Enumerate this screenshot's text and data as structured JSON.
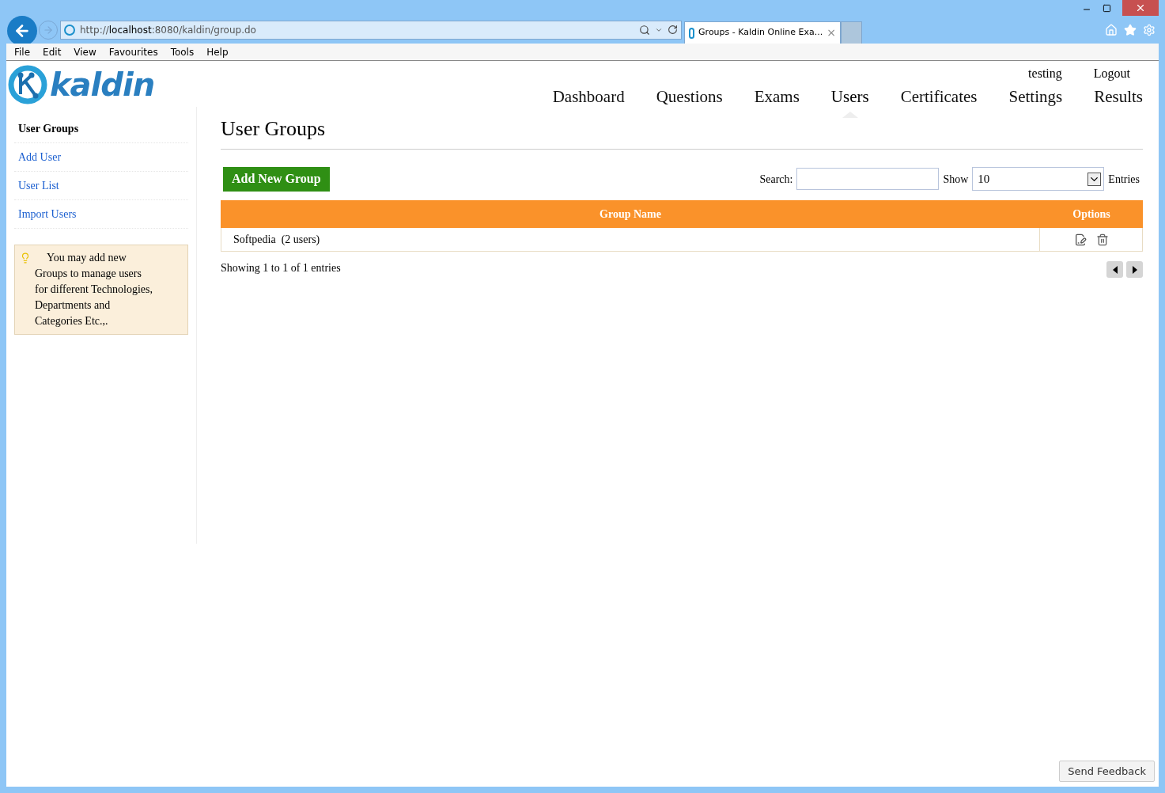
{
  "browser": {
    "url": "http://**localhost**:8080/kaldin/group.do",
    "tab_title": "Groups - Kaldin Online Exa...",
    "tab_close": "×",
    "menu": [
      "File",
      "Edit",
      "View",
      "Favourites",
      "Tools",
      "Help"
    ]
  },
  "header": {
    "logo_text": "kaldin",
    "user": "testing",
    "logout": "Logout",
    "nav": [
      {
        "label": "Dashboard",
        "selected": false
      },
      {
        "label": "Questions",
        "selected": false
      },
      {
        "label": "Exams",
        "selected": false
      },
      {
        "label": "Users",
        "selected": true
      },
      {
        "label": "Certificates",
        "selected": false
      },
      {
        "label": "Settings",
        "selected": false
      },
      {
        "label": "Results",
        "selected": false
      }
    ]
  },
  "sidebar": {
    "items": [
      {
        "label": "User Groups",
        "selected": true
      },
      {
        "label": "Add User",
        "selected": false
      },
      {
        "label": "User List",
        "selected": false
      },
      {
        "label": "Import Users",
        "selected": false
      }
    ],
    "tip": "You may add new Groups to manage users for different Technologies, Departments and Categories Etc.,."
  },
  "main": {
    "title": "User Groups",
    "add_button": "Add New Group",
    "search_label": "Search:",
    "show_label": "Show",
    "page_size": "10",
    "entries_label": "Entries",
    "table": {
      "columns": [
        "Group Name",
        "Options"
      ],
      "rows": [
        {
          "name": "Softpedia  (2 users)"
        }
      ]
    },
    "info": "Showing 1 to 1 of 1 entries"
  },
  "feedback_button": "Send Feedback"
}
